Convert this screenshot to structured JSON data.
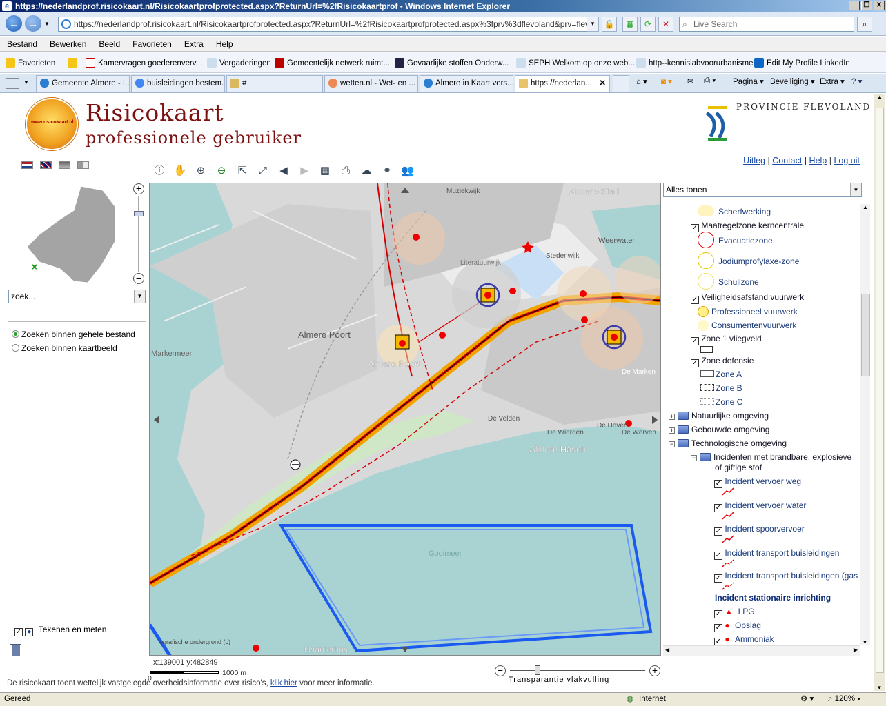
{
  "window": {
    "title": "https://nederlandprof.risicokaart.nl/Risicokaartprofprotected.aspx?ReturnUrl=%2fRisicokaartprof - Windows Internet Explorer"
  },
  "address": {
    "url": "https://nederlandprof.risicokaart.nl/Risicokaartprofprotected.aspx?ReturnUrl=%2fRisicokaartprofprotected.aspx%3fprv%3dflevoland&prv=flevoland&Us",
    "search_placeholder": "Live Search"
  },
  "menu": [
    "Bestand",
    "Bewerken",
    "Beeld",
    "Favorieten",
    "Extra",
    "Help"
  ],
  "favorites": {
    "label": "Favorieten",
    "items": [
      "Kamervragen goederenverv...",
      "Vergaderingen",
      "Gemeentelijk netwerk ruimt...",
      "Gevaarlijke stoffen Onderw...",
      "SEPH  Welkom op onze web...",
      "http--kennislabvoorurbanisme",
      "Edit My Profile  LinkedIn"
    ]
  },
  "tabs": [
    "Gemeente Almere - I...",
    "buisleidingen bestem...",
    "#",
    "wetten.nl - Wet- en ...",
    "Almere in Kaart vers...",
    "https://nederlan..."
  ],
  "commands": {
    "pagina": "Pagina",
    "beveiliging": "Beveiliging",
    "extra": "Extra"
  },
  "header": {
    "title": "Risicokaart",
    "subtitle": "professionele gebruiker",
    "logo_text": "www.risicokaart.nl",
    "province": "Provincie Flevoland"
  },
  "links": {
    "uitleg": "Uitleg",
    "contact": "Contact",
    "help": "Help",
    "logout": "Log uit"
  },
  "search": {
    "value": "zoek...",
    "opt1": "Zoeken binnen gehele bestand",
    "opt2": "Zoeken binnen kaartbeeld"
  },
  "tekenen": "Tekenen en meten",
  "map": {
    "labels": [
      "Muziekwijk",
      "Almere-Stad",
      "Weerwater",
      "Stedenwijk",
      "Literatuurwijk",
      "Almere Poort",
      "Almere Poort",
      "Markermeer",
      "De Velden",
      "De Wierden",
      "De Hoven",
      "De Werven",
      "De Marken",
      "Almere Haven",
      "Gooimeer",
      "Naarderbos",
      "ografische ondergrond (c)"
    ]
  },
  "coords": "x:139001 y:482849",
  "scale": {
    "zero": "0",
    "end": "1000 m"
  },
  "transparantie": "Transparantie vlakvulling",
  "footnote": {
    "text": "De risicokaart toont wettelijk vastgelegde overheidsinformatie over risico's,",
    "link": "klik hier",
    "after": "voor meer informatie."
  },
  "legend": {
    "select": "Alles tonen",
    "scherf": "Scherfwerking",
    "maatregel": "Maatregelzone kerncentrale",
    "evac": "Evacuatiezone",
    "jodium": "Jodiumprofylaxe-zone",
    "schuil": "Schuilzone",
    "veilig": "Veiligheidsafstand vuurwerk",
    "prof": "Professioneel vuurwerk",
    "consument": "Consumentenvuurwerk",
    "zone1": "Zone 1 vliegveld",
    "defensie": "Zone defensie",
    "zoneA": "Zone A",
    "zoneB": "Zone B",
    "zoneC": "Zone C",
    "natuur": "Natuurlijke omgeving",
    "gebouwd": "Gebouwde omgeving",
    "techno": "Technologische omgeving",
    "incidenten1": "Incidenten met brandbare, explosieve",
    "incidenten2": "of giftige stof",
    "weg": "Incident vervoer weg",
    "water": "Incident vervoer water",
    "spoor": "Incident spoorvervoer",
    "buis": "Incident transport buisleidingen",
    "buisgas": "Incident transport buisleidingen (gas",
    "stationair": "Incident stationaire inrichting",
    "lpg": "LPG",
    "opslag": "Opslag",
    "ammoniak": "Ammoniak"
  },
  "status": {
    "left": "Gereed",
    "zone": "Internet",
    "zoom": "120%"
  }
}
